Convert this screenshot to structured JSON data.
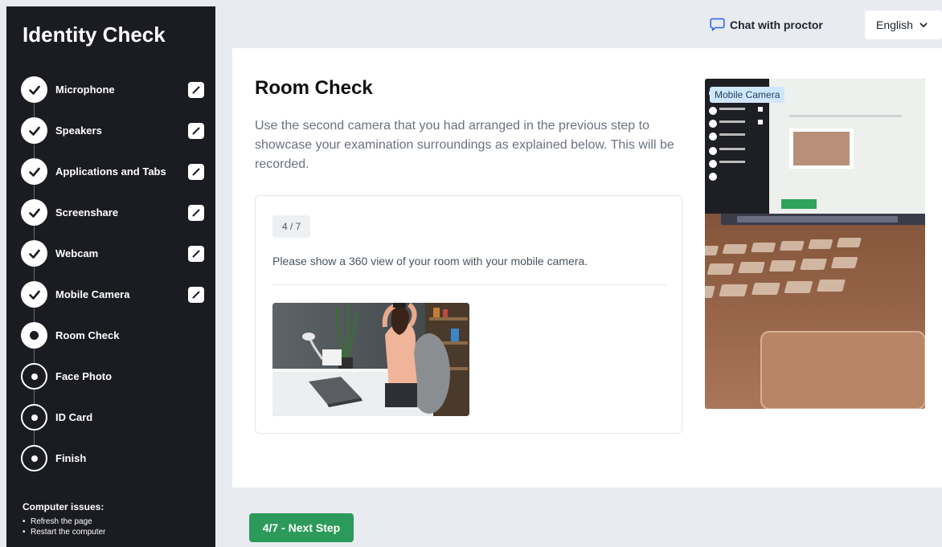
{
  "sidebar": {
    "title": "Identity Check",
    "steps": [
      {
        "label": "Microphone",
        "status": "done"
      },
      {
        "label": "Speakers",
        "status": "done"
      },
      {
        "label": "Applications and Tabs",
        "status": "done"
      },
      {
        "label": "Screenshare",
        "status": "done"
      },
      {
        "label": "Webcam",
        "status": "done"
      },
      {
        "label": "Mobile Camera",
        "status": "done"
      },
      {
        "label": "Room Check",
        "status": "active"
      },
      {
        "label": "Face Photo",
        "status": "pending"
      },
      {
        "label": "ID Card",
        "status": "pending"
      },
      {
        "label": "Finish",
        "status": "pending"
      }
    ],
    "issues": {
      "title": "Computer issues:",
      "items": [
        "Refresh the page",
        "Restart the computer"
      ]
    }
  },
  "topbar": {
    "chat_label": "Chat with proctor",
    "language": "English"
  },
  "main": {
    "title": "Room Check",
    "description": "Use the second camera that you had arranged in the previous step to showcase your examination surroundings as explained below. This will be recorded.",
    "step_badge": "4 / 7",
    "instruction": "Please show a 360 view of your room with your mobile camera.",
    "camera_label": "Mobile Camera"
  },
  "footer": {
    "next_label": "4/7 - Next Step"
  },
  "colors": {
    "sidebar_bg": "#1b1c22",
    "accent_green": "#2c9a5a",
    "camera_tag_bg": "#cfe6ff"
  }
}
